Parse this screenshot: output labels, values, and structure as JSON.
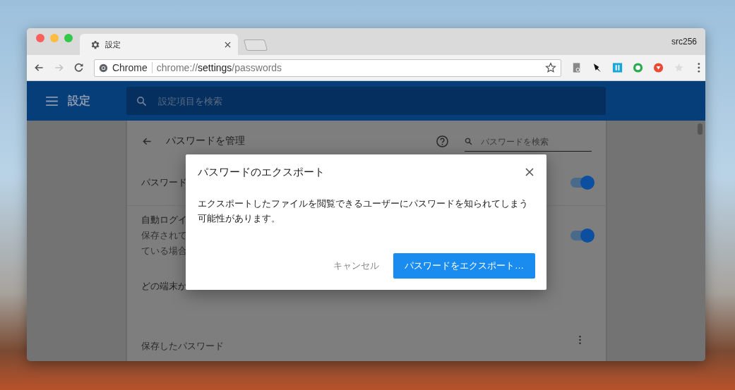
{
  "browser": {
    "tabs": [
      {
        "title": "設定",
        "selected": true
      }
    ],
    "profile": "src256",
    "omnibox": {
      "site_label": "Chrome",
      "url_scheme": "chrome://",
      "url_host": "settings",
      "url_path": "/passwords"
    }
  },
  "settings_header": {
    "title": "設定",
    "search": {
      "placeholder": "設定項目を検索"
    }
  },
  "password_page": {
    "title": "パスワードを管理",
    "search": {
      "placeholder": "パスワードを検索"
    },
    "rows": [
      {
        "kind": "toggle",
        "lines": [
          "パスワード"
        ],
        "on": true
      },
      {
        "kind": "toggle",
        "lines": [
          "自動ログイ",
          "保存されて",
          "ている場合"
        ],
        "on": true
      },
      {
        "kind": "text",
        "lines": [
          "どの端末か"
        ]
      }
    ],
    "saved_heading": "保存したパスワード"
  },
  "dialog": {
    "title": "パスワードのエクスポート",
    "message": "エクスポートしたファイルを閲覧できるユーザーにパスワードを知られてしまう可能性があります。",
    "buttons": [
      {
        "label": "キャンセル",
        "kind": "cancel"
      },
      {
        "label": "パスワードをエクスポート…",
        "kind": "primary"
      }
    ]
  }
}
